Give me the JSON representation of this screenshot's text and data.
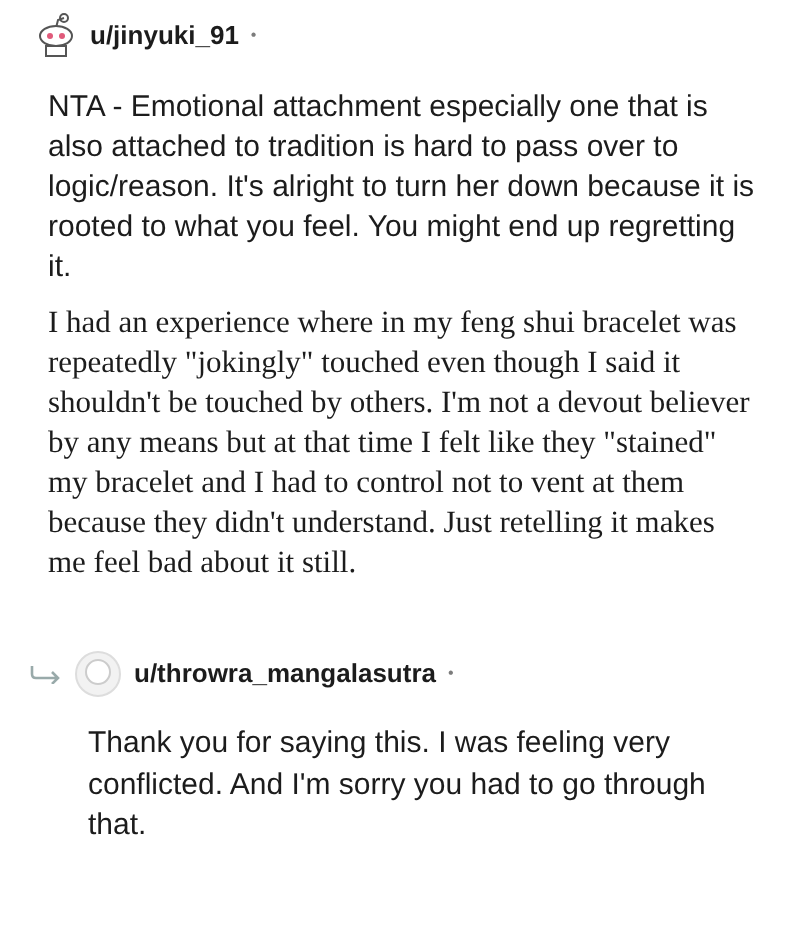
{
  "comment": {
    "username": "u/jinyuki_91",
    "separator": "•",
    "paragraphs": [
      "NTA - Emotional attachment especially one that is also attached to tradition is hard to pass over to logic/reason. It's alright to turn her down because it is rooted to what you feel. You might end up regretting it.",
      "I had an experience where in my feng shui bracelet was repeatedly \"jokingly\" touched even though I said it shouldn't be touched by others. I'm not a devout believer by any means but at that time I felt like they \"stained\" my bracelet and I had to control not to vent at them because they didn't understand. Just retelling it makes me feel bad about it still."
    ]
  },
  "reply": {
    "username": "u/throwra_mangalasutra",
    "separator": "•",
    "paragraphs": [
      "Thank you for saying this. I was feeling very conflicted. And I'm sorry you had to go through that."
    ]
  }
}
